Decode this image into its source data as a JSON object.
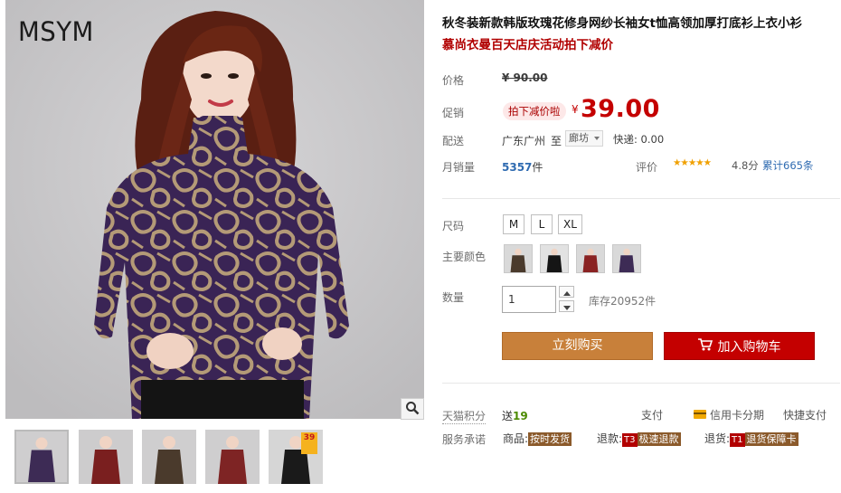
{
  "brand": {
    "logo_text": "MSYM"
  },
  "gallery": {
    "thumbnails": [
      {
        "color": "#3d2b55"
      },
      {
        "color": "#7a1f1f"
      },
      {
        "color": "#4a3a2c"
      },
      {
        "color": "#7e2424"
      },
      {
        "color": "#1a1a1a",
        "badge": "39"
      }
    ]
  },
  "product": {
    "title": "秋冬装新款韩版玫瑰花修身网纱长袖女t恤高领加厚打底衫上衣小衫",
    "subtitle": "慕尚衣曼百天店庆活动拍下减价"
  },
  "price": {
    "label": "价格",
    "original": "¥ 90.00"
  },
  "promo": {
    "label": "促销",
    "tag": "拍下减价啦",
    "yen": "¥",
    "price": "39.00"
  },
  "shipping": {
    "label": "配送",
    "from": "广东广州",
    "to_word": "至",
    "destination": "廊坊",
    "express": "快递: 0.00"
  },
  "sales": {
    "label": "月销量",
    "count": "5357",
    "unit": "件",
    "rating_label": "评价",
    "stars": "★★★★★",
    "score": "4.8分",
    "reviews": "累计665条"
  },
  "size": {
    "label": "尺码",
    "options": [
      "M",
      "L",
      "XL"
    ]
  },
  "color": {
    "label": "主要颜色",
    "options": [
      {
        "name": "color-swatch-1",
        "color": "#4a3a2c"
      },
      {
        "name": "color-swatch-2",
        "color": "#151515"
      },
      {
        "name": "color-swatch-3",
        "color": "#8a2222"
      },
      {
        "name": "color-swatch-4",
        "color": "#3d2b55"
      }
    ]
  },
  "quantity": {
    "label": "数量",
    "value": "1",
    "stock": "库存20952件"
  },
  "actions": {
    "buy_now": "立刻购买",
    "add_to_cart": "加入购物车"
  },
  "points": {
    "label": "天猫积分",
    "prefix": "送",
    "value": "19"
  },
  "payment": {
    "label": "支付",
    "credit": "信用卡分期",
    "quick": "快捷支付"
  },
  "service": {
    "label": "服务承诺",
    "goods_label": "商品:",
    "goods_tag": "按时发货",
    "return_label": "退款:",
    "return_icon": "T3",
    "return_tag": "极速退款",
    "refund_label": "退货:",
    "refund_icon": "T1",
    "refund_tag": "退货保障卡"
  },
  "colors": {
    "promo_red": "#c40000",
    "buy_orange": "#c8803a",
    "link_blue": "#2f6bb1",
    "star_gold": "#f0a000"
  }
}
